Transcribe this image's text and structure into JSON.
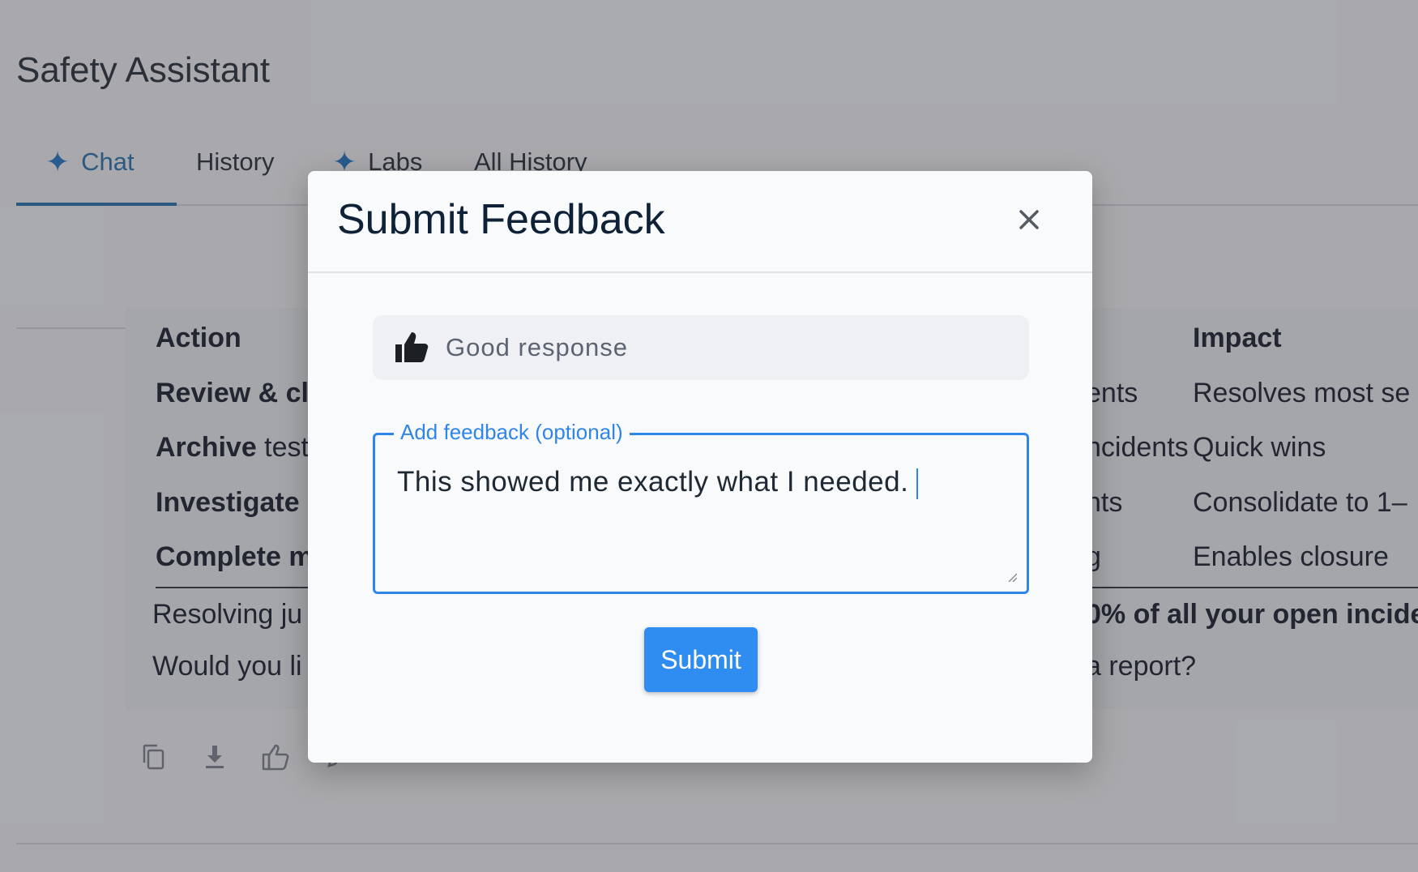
{
  "app": {
    "title": "Safety Assistant"
  },
  "tabs": [
    {
      "label": "Chat",
      "icon": "sparkle-icon",
      "active": true
    },
    {
      "label": "History",
      "icon": null,
      "active": false
    },
    {
      "label": "Labs",
      "icon": "sparkle-icon",
      "active": false
    },
    {
      "label": "All History",
      "icon": null,
      "active": false
    }
  ],
  "response": {
    "table": {
      "headers": [
        "Action",
        "Impact"
      ],
      "rows": [
        {
          "action_bold": "Review & cl",
          "action_rest": "",
          "middle": "ents",
          "impact": "Resolves most se"
        },
        {
          "action_bold": "Archive",
          "action_rest": " test",
          "middle": "ncidents",
          "impact": "Quick wins"
        },
        {
          "action_bold": "Investigate",
          "action_rest": "",
          "middle": "nts",
          "impact": "Consolidate to 1–"
        },
        {
          "action_bold": "Complete m",
          "action_rest": "",
          "middle": "g",
          "impact": "Enables closure"
        }
      ]
    },
    "summary_line_left": "Resolving ju",
    "summary_line_right": "0% of all your open incider",
    "question_left": "Would you li",
    "question_right": "a report?"
  },
  "response_actions": [
    {
      "icon": "copy-icon"
    },
    {
      "icon": "download-icon"
    },
    {
      "icon": "thumbs-up-icon"
    },
    {
      "icon": "edit-icon"
    }
  ],
  "modal": {
    "title": "Submit Feedback",
    "close_icon": "close-icon",
    "rating": {
      "icon": "thumbs-up-filled-icon",
      "label": "Good response"
    },
    "feedback_field": {
      "label": "Add feedback (optional)",
      "value": "This showed me exactly what I needed."
    },
    "submit_label": "Submit"
  },
  "colors": {
    "accent": "#2f8cf0",
    "tab_active": "#1f6fb2",
    "overlay": "rgba(60,60,64,0.42)"
  }
}
